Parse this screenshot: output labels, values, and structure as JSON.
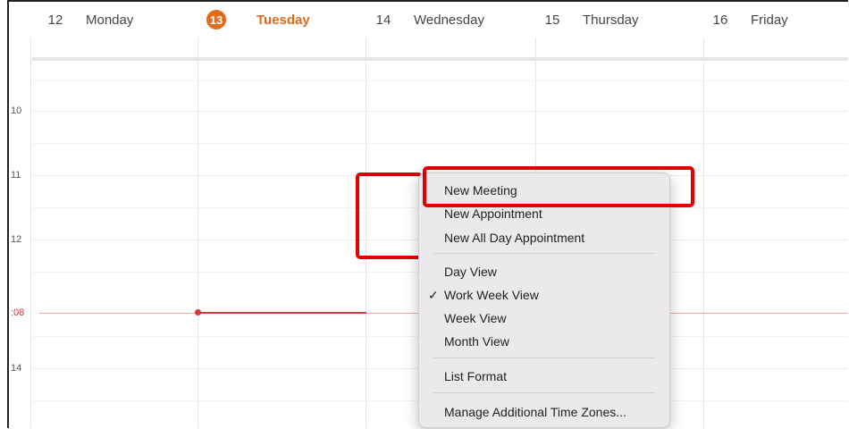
{
  "days": [
    {
      "num": "12",
      "name": "Monday",
      "today": false
    },
    {
      "num": "13",
      "name": "Tuesday",
      "today": true
    },
    {
      "num": "14",
      "name": "Wednesday",
      "today": false
    },
    {
      "num": "15",
      "name": "Thursday",
      "today": false
    },
    {
      "num": "16",
      "name": "Friday",
      "today": false
    }
  ],
  "hours": [
    "10",
    "11",
    "12",
    "14"
  ],
  "now_label": ":08",
  "colors": {
    "today_accent": "#e36a1a",
    "now_line": "#d23a3a",
    "highlight": "#e00000"
  },
  "menu": {
    "new_meeting": "New Meeting",
    "new_appointment": "New Appointment",
    "new_all_day": "New All Day Appointment",
    "day_view": "Day View",
    "work_week_view": "Work Week View",
    "week_view": "Week View",
    "month_view": "Month View",
    "list_format": "List Format",
    "manage_time_zones": "Manage Additional Time Zones...",
    "check_mark": "✓"
  }
}
